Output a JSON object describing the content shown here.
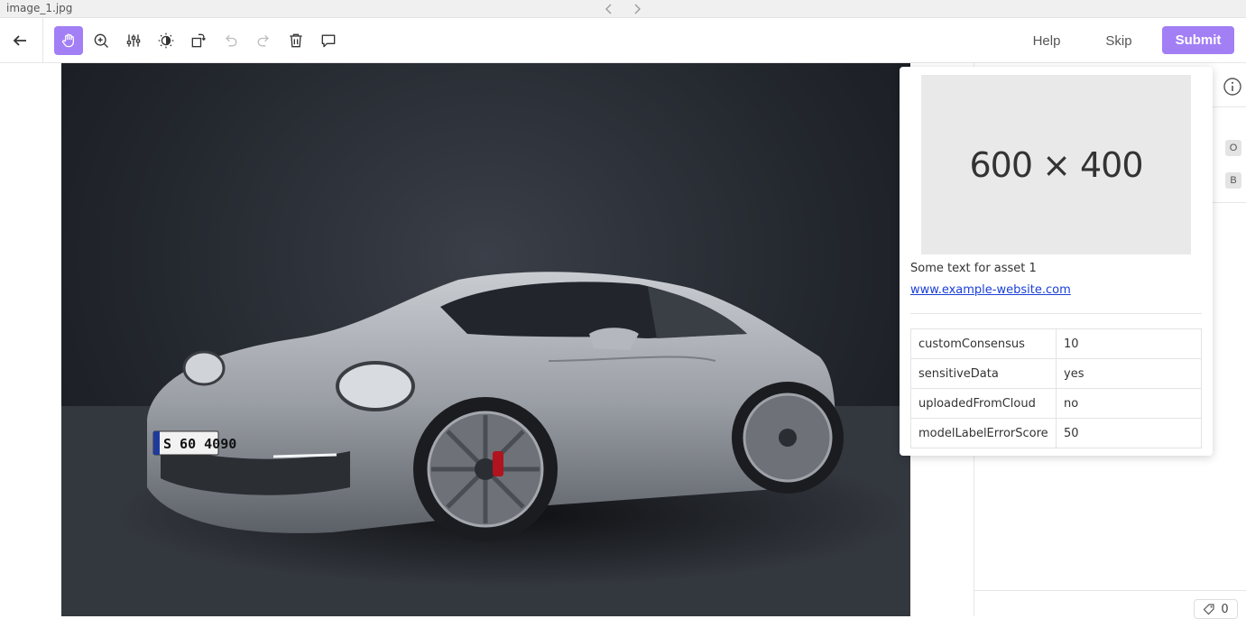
{
  "header": {
    "filename": "image_1.jpg"
  },
  "toolbar": {
    "tools": [
      "hand-icon",
      "zoom-in-icon",
      "sliders-icon",
      "brightness-icon",
      "rotate-icon",
      "undo-icon",
      "redo-icon",
      "trash-icon",
      "comment-icon"
    ],
    "help_label": "Help",
    "skip_label": "Skip",
    "submit_label": "Submit",
    "accent_color": "#a27ff5"
  },
  "canvas": {
    "license_plate": "S 60 4090"
  },
  "popup": {
    "placeholder_text": "600 × 400",
    "asset_text": "Some text for asset 1",
    "link_text": "www.example-website.com",
    "metadata": [
      {
        "key": "customConsensus",
        "value": "10"
      },
      {
        "key": "sensitiveData",
        "value": "yes"
      },
      {
        "key": "uploadedFromCloud",
        "value": "no"
      },
      {
        "key": "modelLabelErrorScore",
        "value": "50"
      }
    ]
  },
  "side_panel": {
    "shortcuts": [
      "O",
      "B"
    ],
    "label_count": "0"
  }
}
